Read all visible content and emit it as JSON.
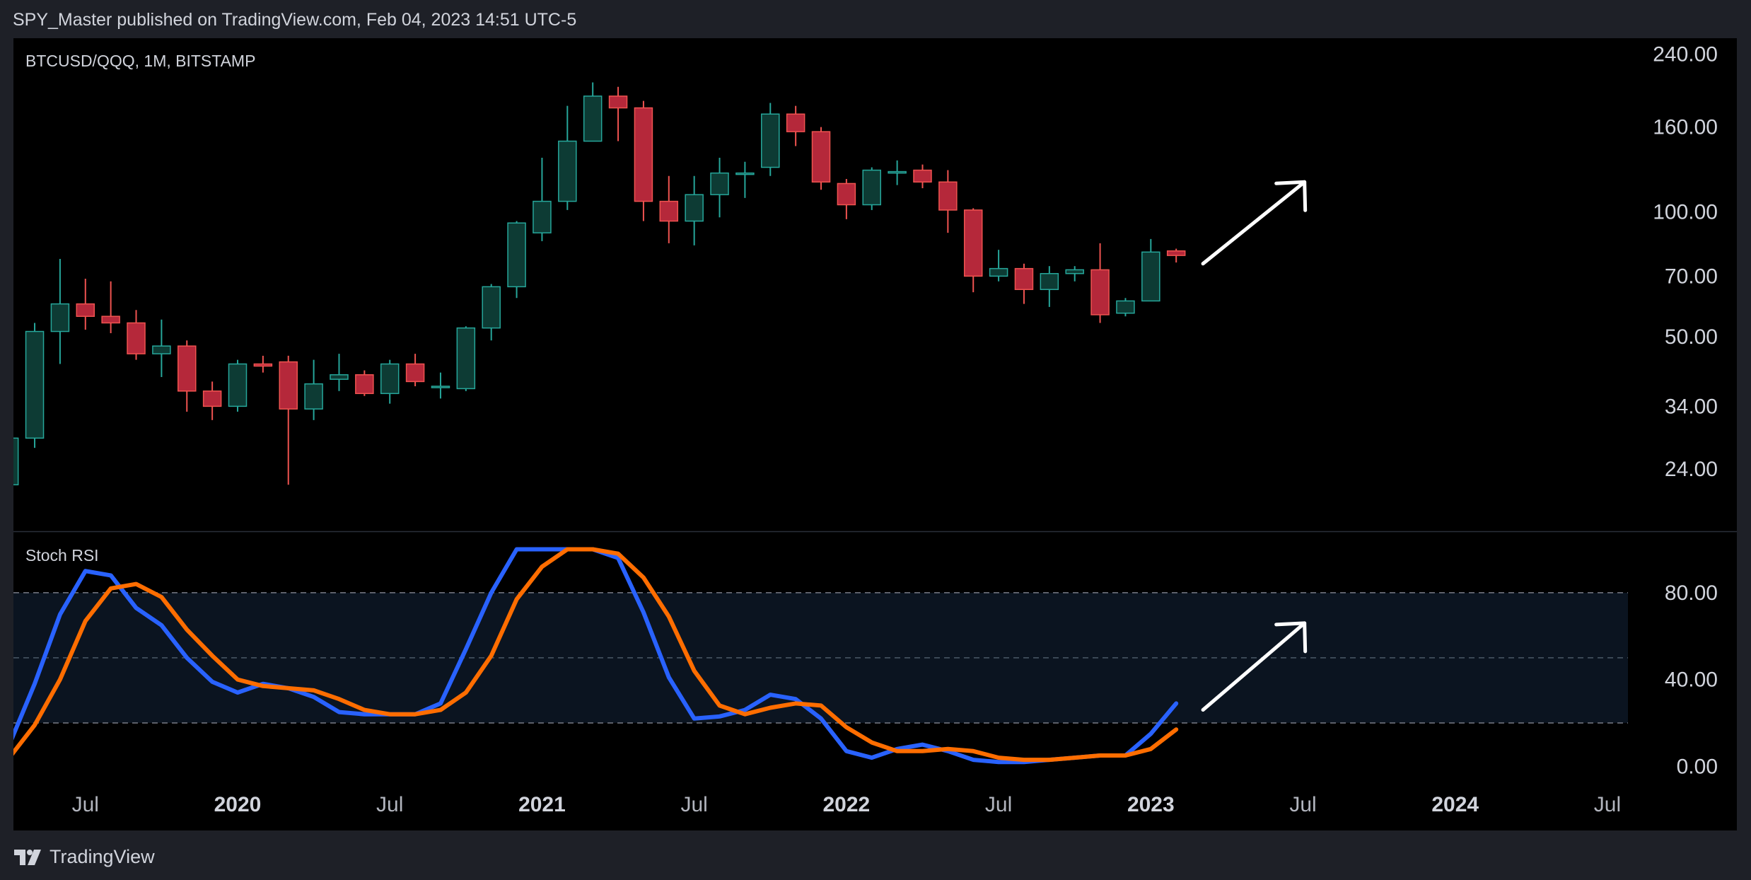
{
  "header": {
    "publisher_line": "SPY_Master published on TradingView.com, Feb 04, 2023 14:51 UTC-5"
  },
  "footer": {
    "brand": "TradingView",
    "logo_icon": "tradingview-logo-icon"
  },
  "colors": {
    "background": "#000000",
    "page": "#1e2027",
    "candle_up": "#0d3b34",
    "candle_up_border": "#26a69a",
    "candle_down": "#b5283a",
    "candle_down_border": "#ef5350",
    "stoch_k": "#2962ff",
    "stoch_d": "#ff6d00",
    "band_fill": "#0b1420",
    "arrow": "#ffffff",
    "text": "#d1d4dc"
  },
  "chart_data": [
    {
      "type": "candlestick",
      "title": "BTCUSD/QQQ, 1M, BITSTAMP",
      "scale": "log",
      "ylim": [
        17,
        262
      ],
      "y_ticks": [
        {
          "value": 240,
          "label": "240.00"
        },
        {
          "value": 160,
          "label": "160.00"
        },
        {
          "value": 100,
          "label": "100.00"
        },
        {
          "value": 70,
          "label": "70.00"
        },
        {
          "value": 50,
          "label": "50.00"
        },
        {
          "value": 34,
          "label": "34.00"
        },
        {
          "value": 24,
          "label": "24.00"
        }
      ],
      "x_ticks": [
        {
          "date": "2019-07",
          "label": "Jul",
          "bold": false
        },
        {
          "date": "2020-01",
          "label": "2020",
          "bold": true
        },
        {
          "date": "2020-07",
          "label": "Jul",
          "bold": false
        },
        {
          "date": "2021-01",
          "label": "2021",
          "bold": true
        },
        {
          "date": "2021-07",
          "label": "Jul",
          "bold": false
        },
        {
          "date": "2022-01",
          "label": "2022",
          "bold": true
        },
        {
          "date": "2022-07",
          "label": "Jul",
          "bold": false
        },
        {
          "date": "2023-01",
          "label": "2023",
          "bold": true
        },
        {
          "date": "2023-07",
          "label": "Jul",
          "bold": false
        },
        {
          "date": "2024-01",
          "label": "2024",
          "bold": true
        },
        {
          "date": "2024-07",
          "label": "Jul",
          "bold": false
        }
      ],
      "candles": [
        {
          "date": "2019-04",
          "o": 22,
          "h": 30,
          "l": 22,
          "c": 28.5
        },
        {
          "date": "2019-05",
          "o": 28.5,
          "h": 54,
          "l": 27,
          "c": 51.5
        },
        {
          "date": "2019-06",
          "o": 51.5,
          "h": 77,
          "l": 43,
          "c": 60
        },
        {
          "date": "2019-07",
          "o": 60,
          "h": 69,
          "l": 52,
          "c": 56
        },
        {
          "date": "2019-08",
          "o": 56,
          "h": 68,
          "l": 51,
          "c": 54
        },
        {
          "date": "2019-09",
          "o": 54,
          "h": 58,
          "l": 44,
          "c": 45.5
        },
        {
          "date": "2019-10",
          "o": 45.5,
          "h": 55,
          "l": 40,
          "c": 47.5
        },
        {
          "date": "2019-11",
          "o": 47.5,
          "h": 49,
          "l": 33,
          "c": 37
        },
        {
          "date": "2019-12",
          "o": 37,
          "h": 39,
          "l": 31.5,
          "c": 34
        },
        {
          "date": "2020-01",
          "o": 34,
          "h": 44,
          "l": 33,
          "c": 43
        },
        {
          "date": "2020-02",
          "o": 43,
          "h": 45,
          "l": 41,
          "c": 42.5
        },
        {
          "date": "2020-03",
          "o": 43.5,
          "h": 45,
          "l": 22,
          "c": 33.5
        },
        {
          "date": "2020-04",
          "o": 33.5,
          "h": 44,
          "l": 31.5,
          "c": 38.5
        },
        {
          "date": "2020-05",
          "o": 39.5,
          "h": 45.5,
          "l": 37,
          "c": 40.5
        },
        {
          "date": "2020-06",
          "o": 40.5,
          "h": 41.5,
          "l": 36,
          "c": 36.5
        },
        {
          "date": "2020-07",
          "o": 36.5,
          "h": 44,
          "l": 34.5,
          "c": 43
        },
        {
          "date": "2020-08",
          "o": 43,
          "h": 45.5,
          "l": 38,
          "c": 39
        },
        {
          "date": "2020-09",
          "o": 38,
          "h": 41,
          "l": 35.5,
          "c": 38
        },
        {
          "date": "2020-10",
          "o": 37.5,
          "h": 53,
          "l": 37,
          "c": 52.5
        },
        {
          "date": "2020-11",
          "o": 52.5,
          "h": 67,
          "l": 49,
          "c": 66
        },
        {
          "date": "2020-12",
          "o": 66,
          "h": 95,
          "l": 62,
          "c": 94
        },
        {
          "date": "2021-01",
          "o": 89,
          "h": 135,
          "l": 85,
          "c": 106
        },
        {
          "date": "2021-02",
          "o": 106,
          "h": 180,
          "l": 101,
          "c": 148
        },
        {
          "date": "2021-03",
          "o": 148,
          "h": 205,
          "l": 148,
          "c": 190
        },
        {
          "date": "2021-04",
          "o": 190,
          "h": 200,
          "l": 148,
          "c": 178
        },
        {
          "date": "2021-05",
          "o": 178,
          "h": 185,
          "l": 95,
          "c": 106
        },
        {
          "date": "2021-06",
          "o": 106,
          "h": 122,
          "l": 84,
          "c": 95
        },
        {
          "date": "2021-07",
          "o": 95,
          "h": 122,
          "l": 83,
          "c": 110
        },
        {
          "date": "2021-08",
          "o": 110,
          "h": 135,
          "l": 97,
          "c": 124
        },
        {
          "date": "2021-09",
          "o": 124,
          "h": 132,
          "l": 108,
          "c": 124
        },
        {
          "date": "2021-10",
          "o": 128,
          "h": 183,
          "l": 122,
          "c": 172
        },
        {
          "date": "2021-11",
          "o": 172,
          "h": 180,
          "l": 144,
          "c": 156
        },
        {
          "date": "2021-12",
          "o": 156,
          "h": 160,
          "l": 113,
          "c": 118
        },
        {
          "date": "2021-01b",
          "o": 117,
          "h": 120,
          "l": 96,
          "c": 104
        },
        {
          "date": "2022-02",
          "o": 104,
          "h": 128,
          "l": 101,
          "c": 126
        },
        {
          "date": "2022-03",
          "o": 124,
          "h": 133,
          "l": 116,
          "c": 125
        },
        {
          "date": "2022-04",
          "o": 126,
          "h": 130,
          "l": 114,
          "c": 118
        },
        {
          "date": "2022-05",
          "o": 118,
          "h": 126,
          "l": 89,
          "c": 101
        },
        {
          "date": "2022-06",
          "o": 101,
          "h": 102,
          "l": 64,
          "c": 70
        },
        {
          "date": "2022-07",
          "o": 70,
          "h": 81,
          "l": 68,
          "c": 73
        },
        {
          "date": "2022-08",
          "o": 73,
          "h": 75,
          "l": 60,
          "c": 65
        },
        {
          "date": "2022-09",
          "o": 65,
          "h": 74,
          "l": 59,
          "c": 71
        },
        {
          "date": "2022-10",
          "o": 71,
          "h": 74,
          "l": 68,
          "c": 72.5
        },
        {
          "date": "2022-11",
          "o": 72.5,
          "h": 84,
          "l": 54,
          "c": 56.5
        },
        {
          "date": "2022-12",
          "o": 57,
          "h": 62,
          "l": 56,
          "c": 61
        },
        {
          "date": "2023-01",
          "o": 61,
          "h": 86,
          "l": 61,
          "c": 80
        },
        {
          "date": "2023-02",
          "o": 80.5,
          "h": 81.5,
          "l": 75.5,
          "c": 78.5
        }
      ],
      "annotations": [
        {
          "type": "arrow",
          "from": {
            "date": "2023-03",
            "value": 75
          },
          "to": {
            "date": "2023-06",
            "value": 118
          }
        }
      ]
    },
    {
      "type": "line",
      "title": "Stoch RSI",
      "ylim": [
        -10,
        108
      ],
      "y_ticks": [
        {
          "value": 80,
          "label": "80.00"
        },
        {
          "value": 40,
          "label": "40.00"
        },
        {
          "value": 0,
          "label": "0.00"
        }
      ],
      "bands": {
        "upper": 80,
        "middle": 50,
        "lower": 20
      },
      "series": [
        {
          "color": "#2962ff",
          "values": [
            10,
            38,
            70,
            90,
            88,
            73,
            65,
            50,
            39,
            34,
            38,
            36,
            32,
            25,
            24,
            24,
            24,
            29,
            54,
            80,
            100,
            100,
            100,
            100,
            96,
            71,
            41,
            22,
            23,
            26,
            33,
            31,
            22,
            7,
            4,
            8,
            10,
            7,
            3,
            2,
            2,
            3,
            4,
            5,
            5,
            15,
            29
          ]
        },
        {
          "color": "#ff6d00",
          "values": [
            4,
            19,
            40,
            67,
            82,
            84,
            78,
            63,
            51,
            40,
            37,
            36,
            35,
            31,
            26,
            24,
            24,
            26,
            34,
            51,
            77,
            92,
            100,
            100,
            98,
            87,
            69,
            44,
            28,
            24,
            27,
            29,
            28,
            18,
            11,
            7,
            7,
            8,
            7,
            4,
            3,
            3,
            4,
            5,
            5,
            8,
            17
          ]
        }
      ],
      "annotations": [
        {
          "type": "arrow",
          "from": {
            "date": "2023-03",
            "value": 26
          },
          "to": {
            "date": "2023-06",
            "value": 66
          }
        }
      ]
    }
  ]
}
